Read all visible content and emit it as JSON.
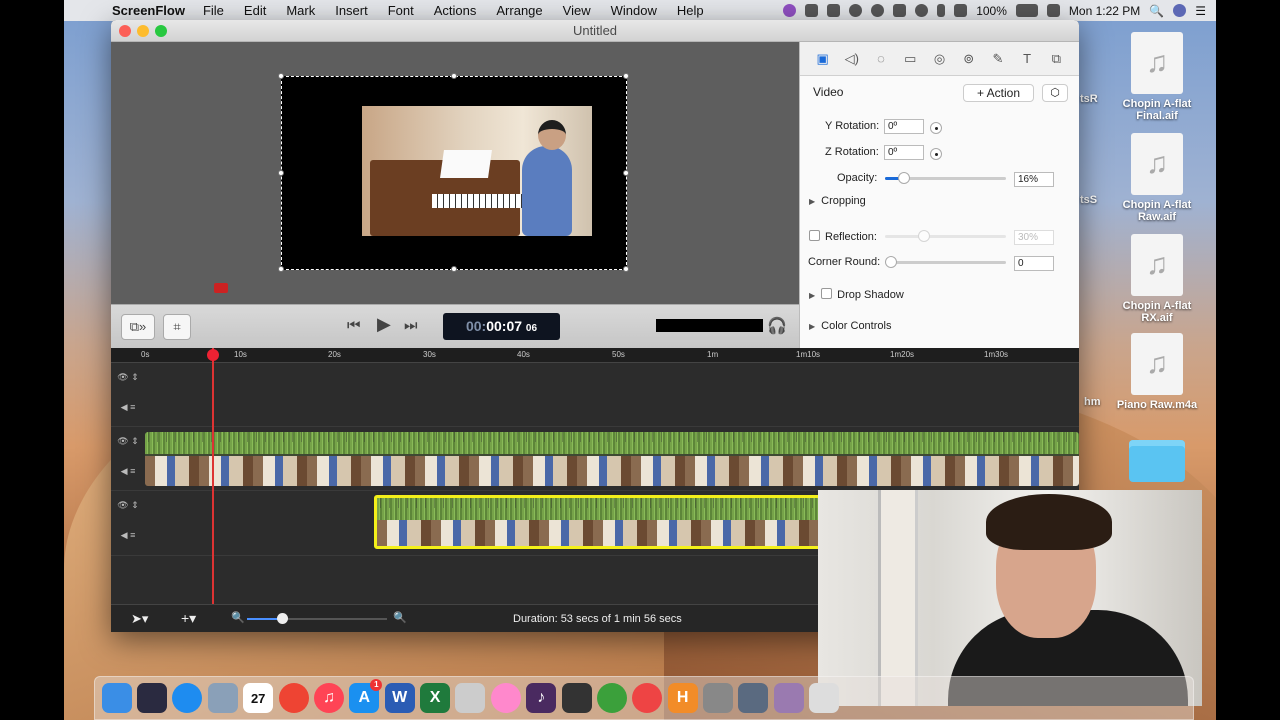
{
  "menubar": {
    "app_name": "ScreenFlow",
    "menus": [
      "File",
      "Edit",
      "Mark",
      "Insert",
      "Font",
      "Actions",
      "Arrange",
      "View",
      "Window",
      "Help"
    ],
    "battery": "100%",
    "clock": "Mon 1:22 PM"
  },
  "desktop": {
    "icons": [
      {
        "label": "Chopin A-flat Final.aif",
        "icon": "audio-file-icon"
      },
      {
        "label": "Chopin A-flat Raw.aif",
        "icon": "audio-file-icon"
      },
      {
        "label": "Chopin A-flat RX.aif",
        "icon": "audio-file-icon"
      },
      {
        "label": "Piano Raw.m4a",
        "icon": "audio-file-icon"
      },
      {
        "label": "",
        "icon": "folder-icon"
      }
    ],
    "partial_labels": [
      "tsR",
      "tsS",
      "hm"
    ]
  },
  "window": {
    "title": "Untitled",
    "transport": {
      "timecode_dim": "00:",
      "timecode_main": "00:07",
      "timecode_frames": "06"
    },
    "inspector": {
      "section_title": "Video",
      "action_button": "+ Action",
      "y_rotation_label": "Y Rotation:",
      "y_rotation_value": "0º",
      "z_rotation_label": "Z Rotation:",
      "z_rotation_value": "0º",
      "opacity_label": "Opacity:",
      "opacity_value": "16%",
      "opacity_level": 0.16,
      "cropping_label": "Cropping",
      "reflection_label": "Reflection:",
      "reflection_value": "30%",
      "corner_round_label": "Corner Round:",
      "corner_round_value": "0",
      "drop_shadow_label": "Drop Shadow",
      "color_controls_label": "Color Controls"
    },
    "timeline": {
      "ruler": [
        "0s",
        "10s",
        "20s",
        "30s",
        "40s",
        "50s",
        "1m",
        "1m10s",
        "1m20s",
        "1m30s"
      ],
      "duration_text": "Duration: 53 secs of 1 min 56 secs"
    }
  },
  "dock": {
    "calendar_date": "27",
    "app_store_badge": "1",
    "letter_apps": [
      "W",
      "X",
      "H"
    ]
  },
  "colors": {
    "selection_yellow": "#f4f01a",
    "playhead_red": "#dd2233",
    "accent_blue": "#1a6ad8",
    "audio_green": "#8ec25a"
  }
}
